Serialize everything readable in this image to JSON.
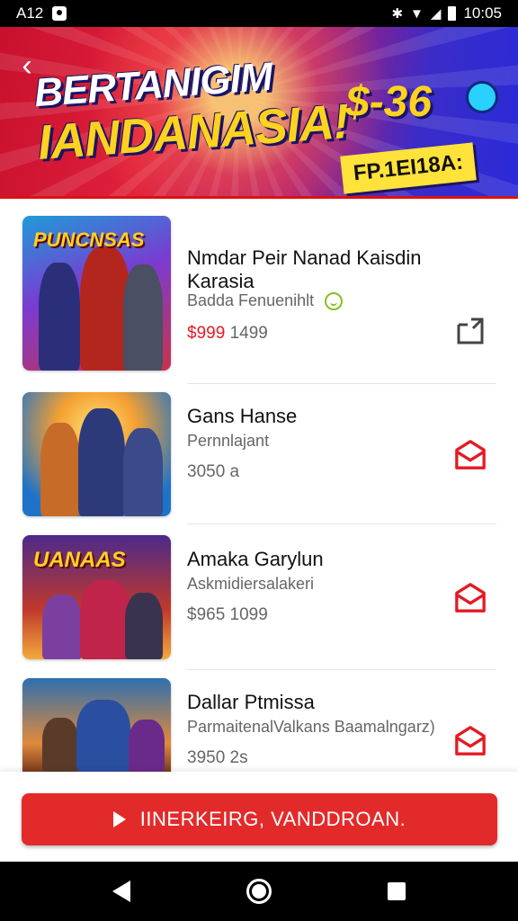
{
  "status_bar": {
    "carrier": "A12",
    "time": "10:05"
  },
  "banner": {
    "title_line1": "BERTANIGIM",
    "title_line2": "IANDANASIA!",
    "price": "$-36",
    "badge": "FP.1EI18A:"
  },
  "items": [
    {
      "title": "Nmdar Peir Nanad Kaisdin Karasia",
      "subtitle": "Badda Fenuenihlt",
      "price_sale": "$999",
      "price_regular": "1499",
      "thumb_tag": "PUNCNSAS",
      "action_icon": "share-icon"
    },
    {
      "title": "Gans Hanse",
      "subtitle": "Pernnlajant",
      "price_sale": "",
      "price_regular": "3050 a",
      "thumb_tag": "",
      "action_icon": "mail-icon"
    },
    {
      "title": "Amaka Garylun",
      "subtitle": "Askmidiersalakeri",
      "price_sale": "",
      "price_regular": "$965 1099",
      "thumb_tag": "UANAAS",
      "action_icon": "mail-icon"
    },
    {
      "title": "Dallar Ptmissa",
      "subtitle": "ParmaitenalValkans Baamalngarz)",
      "price_sale": "",
      "price_regular": "3950 2s",
      "thumb_tag": "",
      "action_icon": "mail-icon"
    }
  ],
  "cta": {
    "label": "IINERKEIRG, VANDDROAN."
  },
  "colors": {
    "accent_red": "#e32a2a",
    "sale_red": "#e31b23"
  }
}
